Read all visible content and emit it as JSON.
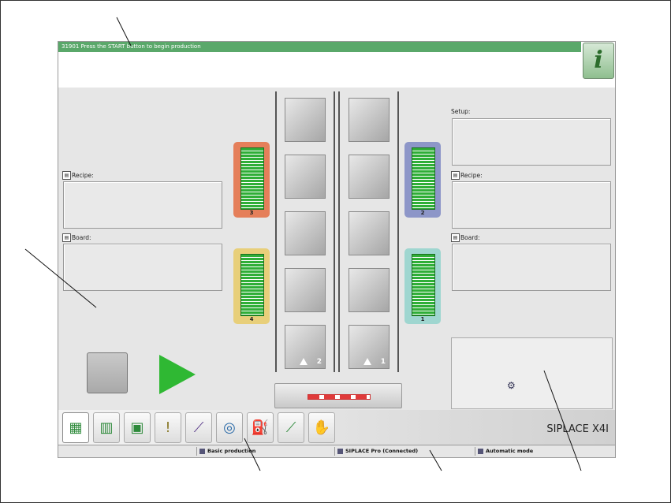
{
  "message": "31901 Press the START button to begin production",
  "info_button_glyph": "i",
  "left": {
    "recipe_label": "Recipe:",
    "board_label": "Board:"
  },
  "right": {
    "setup_label": "Setup:",
    "recipe_label": "Recipe:",
    "board_label": "Board:"
  },
  "magazines": [
    {
      "number": "3",
      "color": "#e57f5a"
    },
    {
      "number": "4",
      "color": "#e8cf7a"
    },
    {
      "number": "2",
      "color": "#8d96c8"
    },
    {
      "number": "1",
      "color": "#9fd6d0"
    }
  ],
  "lane_numbers": {
    "left": "2",
    "right": "1"
  },
  "brand": "SIPLACE X4I",
  "tabs": [
    {
      "name": "tab-production",
      "icon": "stack-icon"
    },
    {
      "name": "tab-grid",
      "icon": "grid-icon"
    },
    {
      "name": "tab-board",
      "icon": "board-icon"
    },
    {
      "name": "tab-messages",
      "icon": "alert-icon"
    },
    {
      "name": "tab-statistics",
      "icon": "chart-icon"
    },
    {
      "name": "tab-camera",
      "icon": "camera-icon"
    },
    {
      "name": "tab-service",
      "icon": "oilcan-icon"
    },
    {
      "name": "tab-tools",
      "icon": "screwdriver-icon"
    },
    {
      "name": "tab-settings",
      "icon": "hand-gear-icon"
    }
  ],
  "footer": {
    "mode": "Basic production",
    "connection": "SIPLACE Pro (Connected)",
    "automatic": "Automatic mode"
  },
  "colors": {
    "status_green": "#5aa86a",
    "play_green": "#2fb833",
    "rack_green": "#2fae37"
  }
}
